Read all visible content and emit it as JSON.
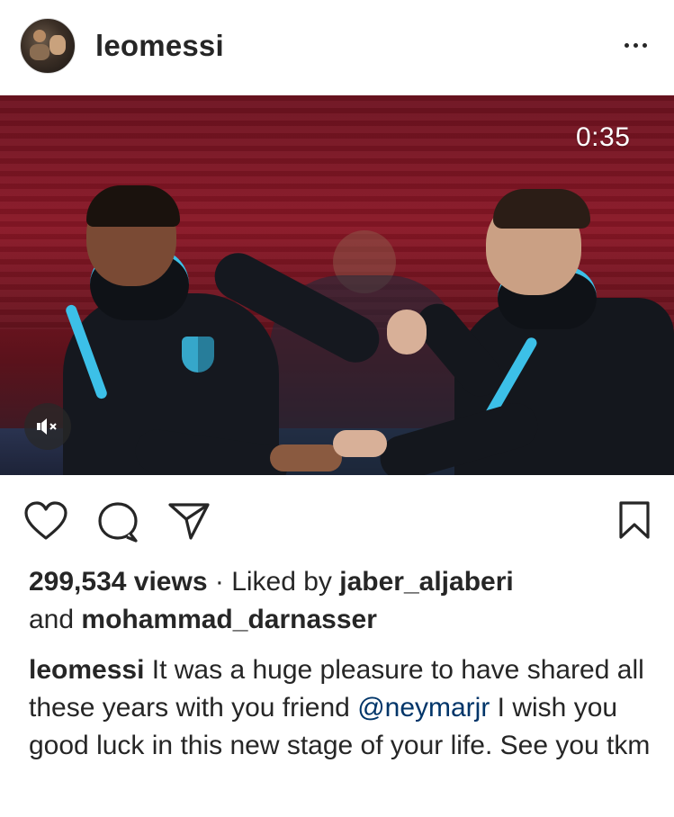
{
  "header": {
    "username": "leomessi"
  },
  "media": {
    "timer": "0:35",
    "mute_icon": "volume-muted-icon"
  },
  "actions": {
    "like_icon": "heart-icon",
    "comment_icon": "comment-bubble-icon",
    "share_icon": "paper-plane-icon",
    "save_icon": "bookmark-icon"
  },
  "stats": {
    "views": "299,534 views",
    "separator": " · ",
    "liked_by_prefix": "Liked by ",
    "liked_by_user": "jaber_aljaberi",
    "and_text": "and ",
    "other_user": "mohammad_darnasser"
  },
  "caption": {
    "author": "leomessi",
    "text_part1": " It was a huge pleasure to have shared all these years with you friend ",
    "mention": "@neymarjr",
    "text_part2": " I wish you good luck in this new stage of your life. See you tkm"
  },
  "colors": {
    "text": "#262626",
    "mention": "#003569",
    "jersey_accent": "#3cc0e8"
  }
}
